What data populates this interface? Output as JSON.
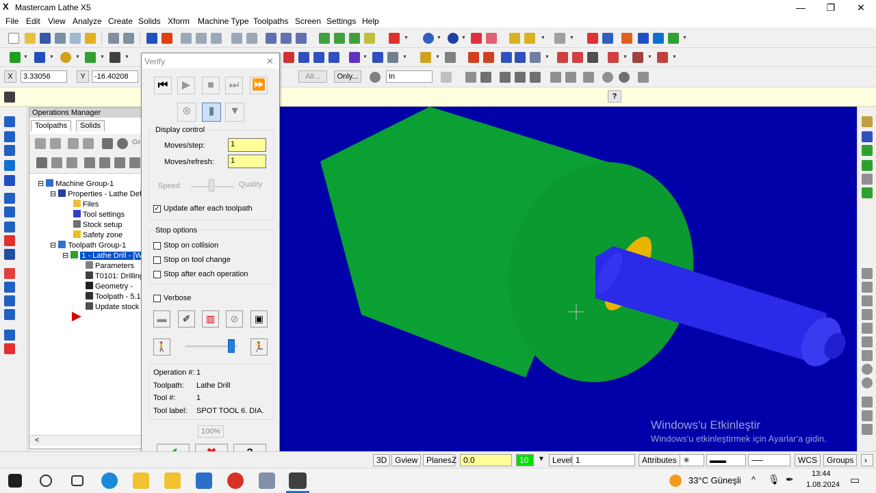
{
  "window": {
    "title": "Mastercam Lathe X5",
    "minimize": "—",
    "maximize": "❐",
    "close": "✕"
  },
  "menu": [
    "File",
    "Edit",
    "View",
    "Analyze",
    "Create",
    "Solids",
    "Xform",
    "Machine Type",
    "Toolpaths",
    "Screen",
    "Settings",
    "Help"
  ],
  "coords": {
    "x_label": "X",
    "x_value": "3.33056",
    "y_label": "Y",
    "y_value": "-16.40208"
  },
  "toolbar3": {
    "all_button": "All...",
    "only_button": "Only...",
    "units_value": "In"
  },
  "prompt_help": "?",
  "opman": {
    "title": "Operations Manager",
    "tabs": [
      "Toolpaths",
      "Solids"
    ],
    "truncated_btn": "Gr",
    "tree": [
      "Machine Group-1",
      "Properties - Lathe Defa",
      "Files",
      "Tool settings",
      "Stock setup",
      "Safety zone",
      "Toolpath Group-1",
      "1 - Lathe Drill - [W",
      "Parameters",
      "T0101: Drilling",
      "Geometry -",
      "Toolpath - 5.1",
      "Update stock"
    ]
  },
  "verify": {
    "title": "Verify",
    "close": "✕",
    "display_control": "Display control",
    "moves_step_label": "Moves/step:",
    "moves_step_value": "1",
    "moves_refresh_label": "Moves/refresh:",
    "moves_refresh_value": "1",
    "speed_label": "Speed",
    "quality_label": "Quality",
    "update_after_toolpath": "Update after each toolpath",
    "update_after_checked": true,
    "stop_options": "Stop options",
    "stop_collision": "Stop on collision",
    "stop_tool_change": "Stop on tool change",
    "stop_after_op": "Stop after each operation",
    "verbose": "Verbose",
    "info": [
      {
        "label": "Operation #:",
        "value": "1"
      },
      {
        "label": "Toolpath:",
        "value": "Lathe Drill"
      },
      {
        "label": "Tool #:",
        "value": "1"
      },
      {
        "label": "Tool label:",
        "value": "SPOT TOOL  6. DIA."
      }
    ],
    "progress": "100%",
    "ok": "✔",
    "cancel": "✖",
    "help": "?"
  },
  "statusbar": {
    "view3d": "3D",
    "gview": "Gview",
    "planes": "Planes",
    "z_label": "Z",
    "z_value": "0.0",
    "color_value": "10",
    "level_label": "Level",
    "level_value": "1",
    "attributes": "Attributes",
    "wcs": "WCS",
    "groups": "Groups"
  },
  "watermark": {
    "line1": "Windows'u Etkinleştir",
    "line2": "Windows'u etkinleştirmek için Ayarlar'a gidin."
  },
  "taskbar": {
    "weather": "33°C  Güneşli",
    "time": "13:44",
    "date": "1.08.2024"
  },
  "colors": {
    "viewport_bg": "#0000a8",
    "stock_green": "#0aa033",
    "part_blue": "#2a2ae8",
    "chamfer_yellow": "#e8b400",
    "field_yellow": "#ffff99"
  }
}
